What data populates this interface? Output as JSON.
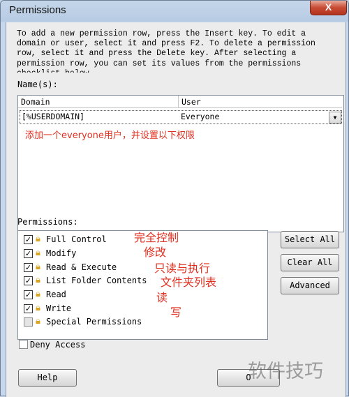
{
  "window": {
    "title": "Permissions",
    "close_label": "X"
  },
  "instructions": "To add a new permission row, press the Insert key. To edit a\ndomain or user, select it and press F2. To delete a permission\nrow, select it and press the Delete key. After selecting a\npermission row, you can set its values from the permissions\nchecklist below.",
  "names": {
    "label": "Name(s):",
    "columns": [
      "Domain",
      "User"
    ],
    "rows": [
      {
        "domain": "[%USERDOMAIN]",
        "user": "Everyone"
      }
    ],
    "note": "添加一个everyone用户，并设置以下权限"
  },
  "permissions": {
    "label": "Permissions:",
    "items": [
      {
        "label": "Full Control",
        "checked": true,
        "note": "完全控制"
      },
      {
        "label": "Modify",
        "checked": true,
        "note": "修改"
      },
      {
        "label": "Read & Execute",
        "checked": true,
        "note": "只读与执行"
      },
      {
        "label": "List Folder Contents",
        "checked": true,
        "note": "文件夹列表"
      },
      {
        "label": "Read",
        "checked": true,
        "note": "读"
      },
      {
        "label": "Write",
        "checked": true,
        "note": "写"
      },
      {
        "label": "Special Permissions",
        "checked": false,
        "note": ""
      }
    ]
  },
  "buttons": {
    "select_all": "Select All",
    "clear_all": "Clear All",
    "advanced": "Advanced",
    "help": "Help",
    "ok": "O"
  },
  "deny_access": {
    "label": "Deny Access",
    "checked": false
  },
  "watermark": "软件技巧"
}
